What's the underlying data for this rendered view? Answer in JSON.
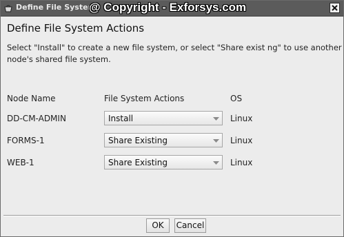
{
  "window": {
    "title": "Define File System",
    "watermark": "@ Copyright - Exforsys.com",
    "close_icon": "close-icon"
  },
  "dialog": {
    "heading": "Define File System Actions",
    "instruction_line1": "Select \"Install\" to create a new file system, or select \"Share exist ng\" to use another",
    "instruction_line2": "node's shared file system."
  },
  "table": {
    "headers": {
      "node_name": "Node Name",
      "actions": "File System Actions",
      "os": "OS"
    },
    "rows": [
      {
        "node": "DD-CM-ADMIN",
        "action": "Install",
        "os": "Linux"
      },
      {
        "node": "FORMS-1",
        "action": "Share Existing",
        "os": "Linux"
      },
      {
        "node": "WEB-1",
        "action": "Share Existing",
        "os": "Linux"
      }
    ]
  },
  "buttons": {
    "ok": "OK",
    "cancel": "Cancel"
  }
}
